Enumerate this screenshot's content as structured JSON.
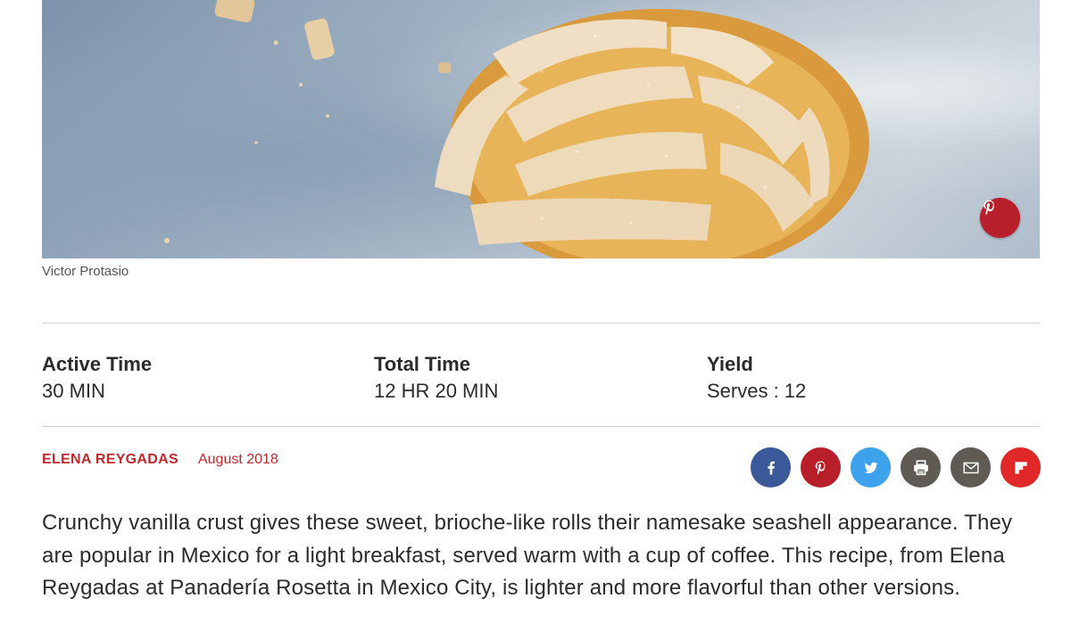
{
  "hero": {
    "caption": "Victor Protasio",
    "pin_icon": "pinterest-icon"
  },
  "meta": {
    "active_time": {
      "label": "Active Time",
      "value": "30 MIN"
    },
    "total_time": {
      "label": "Total Time",
      "value": "12 HR 20 MIN"
    },
    "yield": {
      "label": "Yield",
      "value": "Serves : 12"
    }
  },
  "byline": {
    "author": "ELENA REYGADAS",
    "date": "August 2018"
  },
  "share": [
    {
      "name": "facebook",
      "icon": "facebook-icon",
      "color": "#3b5998"
    },
    {
      "name": "pinterest",
      "icon": "pinterest-icon",
      "color": "#b7202b"
    },
    {
      "name": "twitter",
      "icon": "twitter-icon",
      "color": "#3ea1ec"
    },
    {
      "name": "print",
      "icon": "print-icon",
      "color": "#5f5b54"
    },
    {
      "name": "email",
      "icon": "email-icon",
      "color": "#5f5b54"
    },
    {
      "name": "flipboard",
      "icon": "flipboard-icon",
      "color": "#e12828"
    }
  ],
  "description": "Crunchy vanilla crust gives these sweet, brioche-like rolls their namesake seashell appearance. They are popular in Mexico for a light breakfast, served warm with a cup of coffee. This recipe, from Elena Reygadas at Panadería Rosetta in Mexico City, is lighter and more flavorful than other versions.",
  "colors": {
    "accent_red": "#c1272d",
    "text": "#2b2b2b",
    "rule": "#d0d0d0"
  }
}
